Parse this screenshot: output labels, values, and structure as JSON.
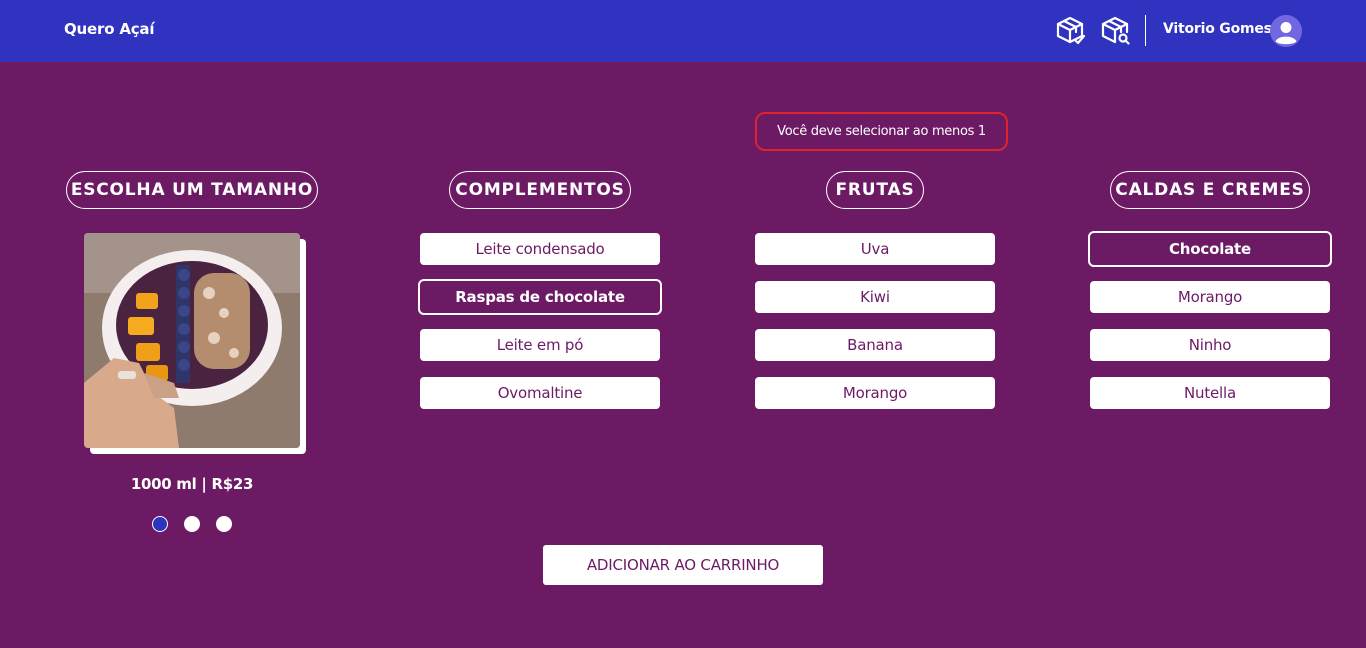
{
  "header": {
    "logo": "Quero Açaí",
    "icons": [
      "box-check-icon",
      "box-search-icon"
    ],
    "username": "Vitorio Gomes",
    "avatar_icon": "user-avatar-icon"
  },
  "warning": "Você deve selecionar ao menos 1",
  "size": {
    "title": "ESCOLHA UM TAMANHO",
    "label": "1000 ml | R$23",
    "active_dot": 0,
    "dot_count": 3
  },
  "complementos": {
    "title": "COMPLEMENTOS",
    "options": [
      {
        "label": "Leite condensado",
        "selected": false
      },
      {
        "label": "Raspas de chocolate",
        "selected": true
      },
      {
        "label": "Leite em pó",
        "selected": false
      },
      {
        "label": "Ovomaltine",
        "selected": false
      }
    ]
  },
  "frutas": {
    "title": "FRUTAS",
    "options": [
      {
        "label": "Uva",
        "selected": false
      },
      {
        "label": "Kiwi",
        "selected": false
      },
      {
        "label": "Banana",
        "selected": false
      },
      {
        "label": "Morango",
        "selected": false
      }
    ]
  },
  "caldas": {
    "title": "CALDAS E CREMES",
    "options": [
      {
        "label": "Chocolate",
        "selected": true
      },
      {
        "label": "Morango",
        "selected": false
      },
      {
        "label": "Ninho",
        "selected": false
      },
      {
        "label": "Nutella",
        "selected": false
      }
    ]
  },
  "cart_button": "ADICIONAR AO CARRINHO",
  "colors": {
    "header": "#2f33c0",
    "background": "#6d1a65",
    "warning_border": "#e0222a"
  }
}
